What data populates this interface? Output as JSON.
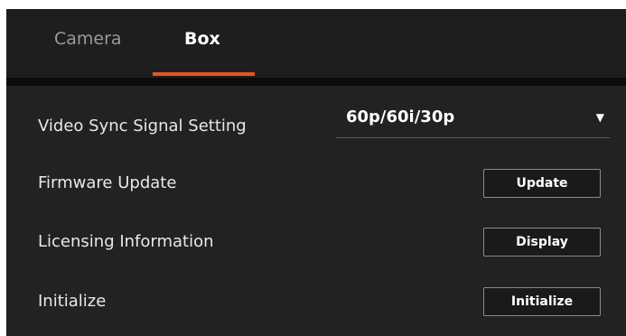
{
  "tabs": [
    {
      "label": "Camera",
      "active": false
    },
    {
      "label": "Box",
      "active": true
    }
  ],
  "colors": {
    "accent": "#e8521d",
    "background": "#222222",
    "text": "#e8e8e8"
  },
  "settings": {
    "video_sync": {
      "label": "Video Sync Signal Setting",
      "value": "60p/60i/30p",
      "arrow_icon": "dropdown-triangle-icon"
    },
    "firmware": {
      "label": "Firmware Update",
      "button": "Update"
    },
    "licensing": {
      "label": "Licensing Information",
      "button": "Display"
    },
    "initialize": {
      "label": "Initialize",
      "button": "Initialize"
    }
  }
}
